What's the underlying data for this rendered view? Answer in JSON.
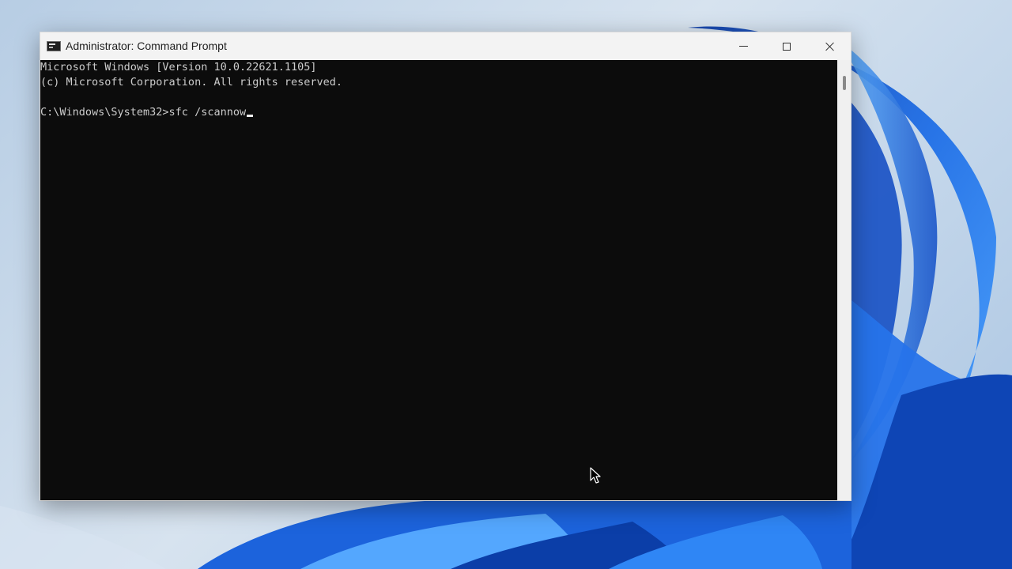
{
  "window": {
    "title": "Administrator: Command Prompt",
    "controls": {
      "minimize": "minimize",
      "maximize": "maximize",
      "close": "close"
    }
  },
  "terminal": {
    "lines": [
      "Microsoft Windows [Version 10.0.22621.1105]",
      "(c) Microsoft Corporation. All rights reserved.",
      "",
      "C:\\Windows\\System32>sfc /scannow"
    ]
  },
  "colors": {
    "terminal_background": "#0c0c0c",
    "terminal_text": "#cccccc",
    "titlebar": "#f3f3f3",
    "wallpaper_accent": "#1f5fd8"
  },
  "icons": {
    "app": "cmd-icon",
    "cursor": "mouse-pointer-icon"
  }
}
